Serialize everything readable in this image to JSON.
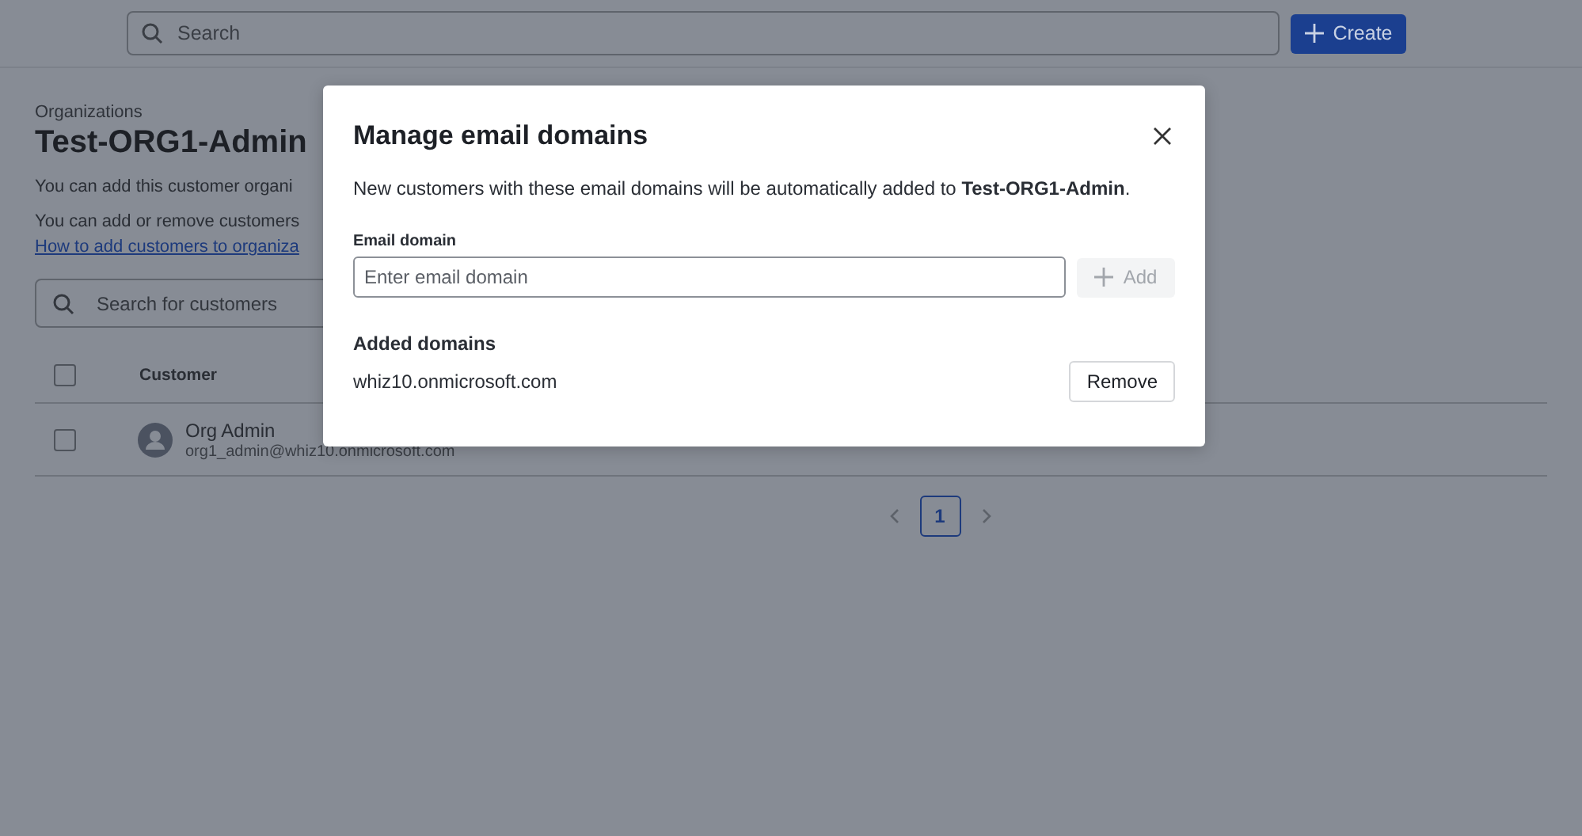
{
  "topbar": {
    "search": {
      "placeholder": "Search"
    },
    "create_button": "Create"
  },
  "page": {
    "breadcrumb": "Organizations",
    "title": "Test-ORG1-Admin",
    "line_1": "You can add this customer organi",
    "line_2": "You can add or remove customers",
    "link": "How to add customers to organiza",
    "search": {
      "placeholder": "Search for customers"
    },
    "table": {
      "header_checked": false,
      "columns": [
        "Customer"
      ],
      "rows": [
        {
          "checked": false,
          "name": "Org Admin",
          "email": "org1_admin@whiz10.onmicrosoft.com"
        }
      ]
    },
    "pagination": {
      "pages": [
        {
          "label": "1",
          "selected": true
        }
      ]
    }
  },
  "dialog": {
    "title": "Manage email domains",
    "description": "New customers with these email domains will be automatically added to **Test-ORG1-Admin**.",
    "field_label": "Email domain",
    "field": {
      "placeholder": "Enter email domain"
    },
    "add_button": {
      "label": "Add",
      "disabled": true
    },
    "section_title": "Added domains",
    "domains": [
      {
        "name": "whiz10.onmicrosoft.com",
        "button": "Remove"
      }
    ]
  }
}
